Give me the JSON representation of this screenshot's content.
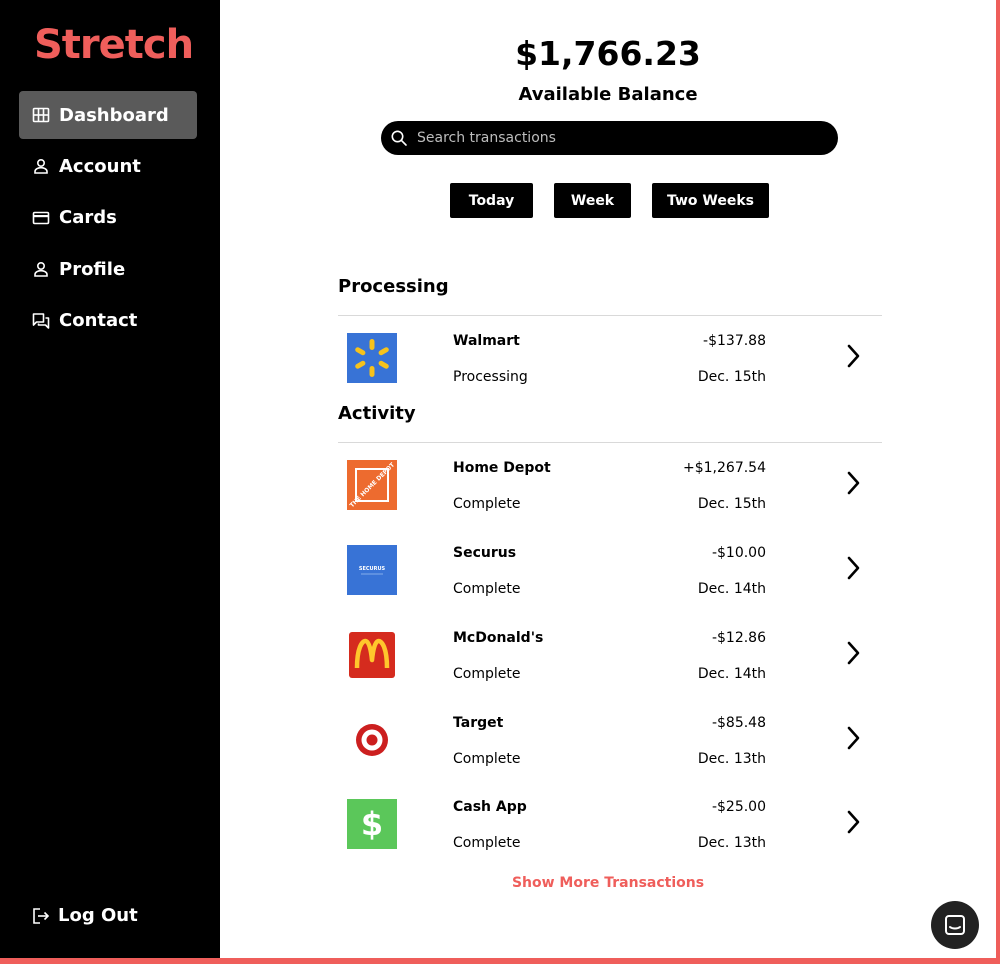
{
  "brand": {
    "name": "Stretch",
    "accent": "#ef5e5b"
  },
  "sidebar": {
    "items": [
      {
        "label": "Dashboard",
        "icon": "grid-icon",
        "active": true
      },
      {
        "label": "Account",
        "icon": "user-icon"
      },
      {
        "label": "Cards",
        "icon": "card-icon"
      },
      {
        "label": "Profile",
        "icon": "user-icon"
      },
      {
        "label": "Contact",
        "icon": "chat-icon"
      }
    ],
    "logout_label": "Log Out"
  },
  "balance": {
    "amount": "$1,766.23",
    "label": "Available Balance"
  },
  "search": {
    "placeholder": "Search transactions"
  },
  "filters": [
    "Today",
    "Week",
    "Two Weeks"
  ],
  "processing": {
    "title": "Processing",
    "transactions": [
      {
        "name": "Walmart",
        "status": "Processing",
        "amount": "-$137.88",
        "date": "Dec. 15th",
        "logo": "walmart-logo"
      }
    ]
  },
  "activity": {
    "title": "Activity",
    "transactions": [
      {
        "name": "Home Depot",
        "status": "Complete",
        "amount": "+$1,267.54",
        "date": "Dec. 15th",
        "logo": "home-depot-logo",
        "logo_text": "THE HOME DEPOT"
      },
      {
        "name": "Securus",
        "status": "Complete",
        "amount": "-$10.00",
        "date": "Dec. 14th",
        "logo": "securus-logo",
        "logo_text": "SECURUS"
      },
      {
        "name": "McDonald's",
        "status": "Complete",
        "amount": "-$12.86",
        "date": "Dec. 14th",
        "logo": "mcdonalds-logo"
      },
      {
        "name": "Target",
        "status": "Complete",
        "amount": "-$85.48",
        "date": "Dec. 13th",
        "logo": "target-logo"
      },
      {
        "name": "Cash App",
        "status": "Complete",
        "amount": "-$25.00",
        "date": "Dec. 13th",
        "logo": "cash-app-logo"
      }
    ]
  },
  "show_more_label": "Show More Transactions"
}
